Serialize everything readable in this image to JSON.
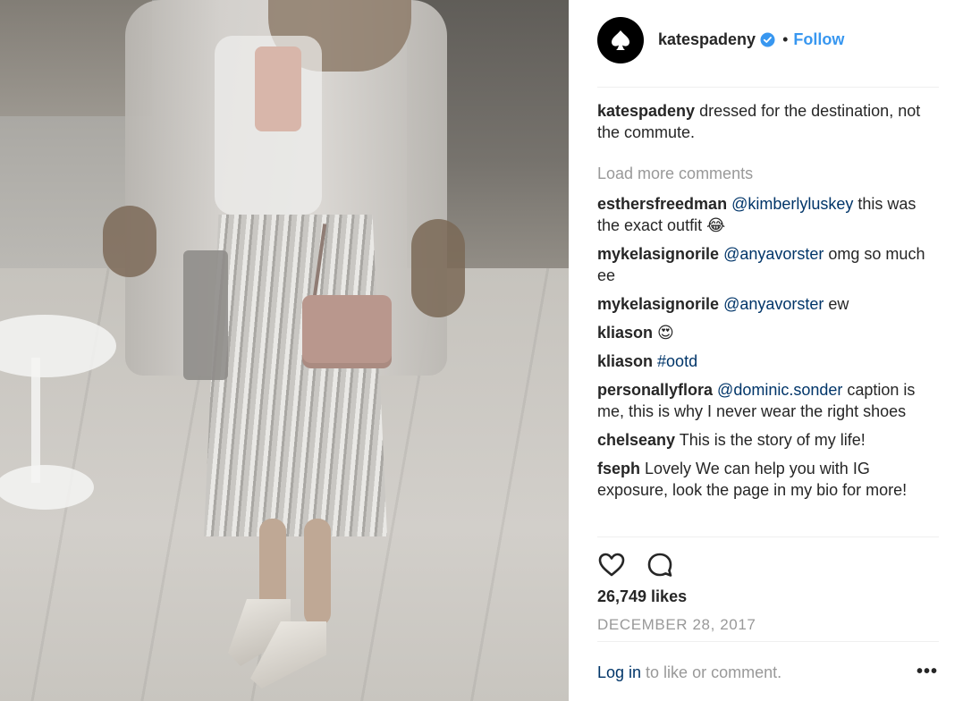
{
  "post": {
    "username": "katespadeny",
    "follow_label": "Follow",
    "separator": "•",
    "caption_user": "katespadeny",
    "caption_text": " dressed for the destination, not the commute.",
    "load_more": "Load more comments",
    "comments": [
      {
        "user": "esthersfreedman",
        "mention": " @kimberlyluskey",
        "text": " this was the exact outfit 😂"
      },
      {
        "user": "mykelasignorile",
        "mention": " @anyavorster",
        "text": " omg so much ee"
      },
      {
        "user": "mykelasignorile",
        "mention": " @anyavorster",
        "text": " ew"
      },
      {
        "user": "kliason",
        "mention": "",
        "text": " 😍"
      },
      {
        "user": "kliason",
        "mention": " #ootd",
        "text": ""
      },
      {
        "user": "personallyflora",
        "mention": " @dominic.sonder",
        "text": " caption is me, this is why I never wear the right shoes"
      },
      {
        "user": "chelseany",
        "mention": "",
        "text": " This is the story of my life!"
      },
      {
        "user": "fseph",
        "mention": "",
        "text": " Lovely We can help you with IG exposure, look the page in my bio for more!"
      }
    ],
    "likes": "26,749 likes",
    "date": "DECEMBER 28, 2017",
    "login_link": "Log in",
    "login_text": " to like or comment.",
    "more_label": "•••"
  },
  "icons": {
    "avatar": "spade-logo-icon",
    "verified": "verified-badge-icon",
    "like": "heart-icon",
    "comment": "comment-bubble-icon",
    "more": "more-options-icon"
  },
  "colors": {
    "link_blue": "#3897f0",
    "mention_blue": "#003569",
    "muted": "#999999",
    "text": "#262626"
  }
}
